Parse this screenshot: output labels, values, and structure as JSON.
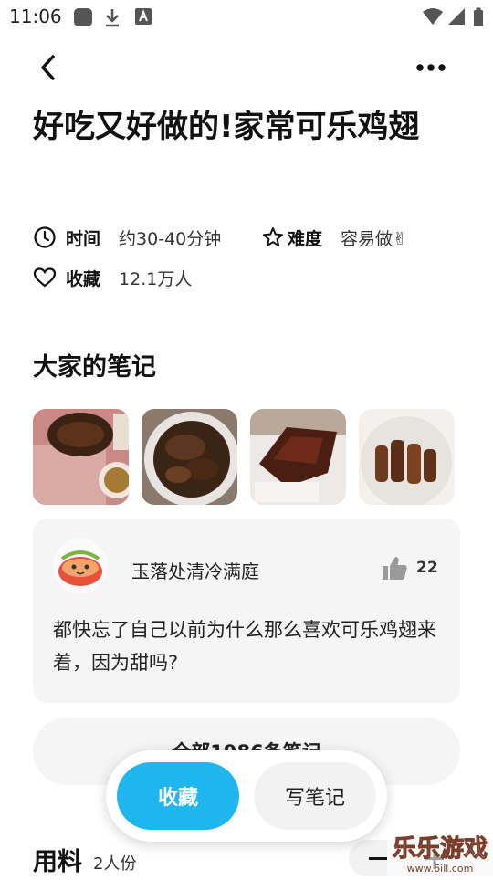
{
  "status_bar": {
    "time": "11:06"
  },
  "recipe": {
    "title": "好吃又好做的!家常可乐鸡翅",
    "time_label": "时间",
    "time_value": "约30-40分钟",
    "difficulty_label": "难度",
    "difficulty_value": "容易做✌",
    "favorites_label": "收藏",
    "favorites_value": "12.1万人"
  },
  "notes": {
    "section_title": "大家的笔记",
    "featured": {
      "username": "玉落处清冷满庭",
      "likes": "22",
      "text": "都快忘了自己以前为什么那么喜欢可乐鸡翅来着，因为甜吗?"
    },
    "all_notes_label": "全部1986条笔记"
  },
  "actions": {
    "favorite_label": "收藏",
    "write_note_label": "写笔记"
  },
  "ingredients": {
    "title": "用料",
    "servings": "2人份"
  },
  "watermark": {
    "text": "乐乐游戏",
    "url": "www.6ill.com"
  },
  "colors": {
    "accent": "#1fb5ef",
    "card_bg": "#f5f5f5",
    "text": "#111111"
  }
}
